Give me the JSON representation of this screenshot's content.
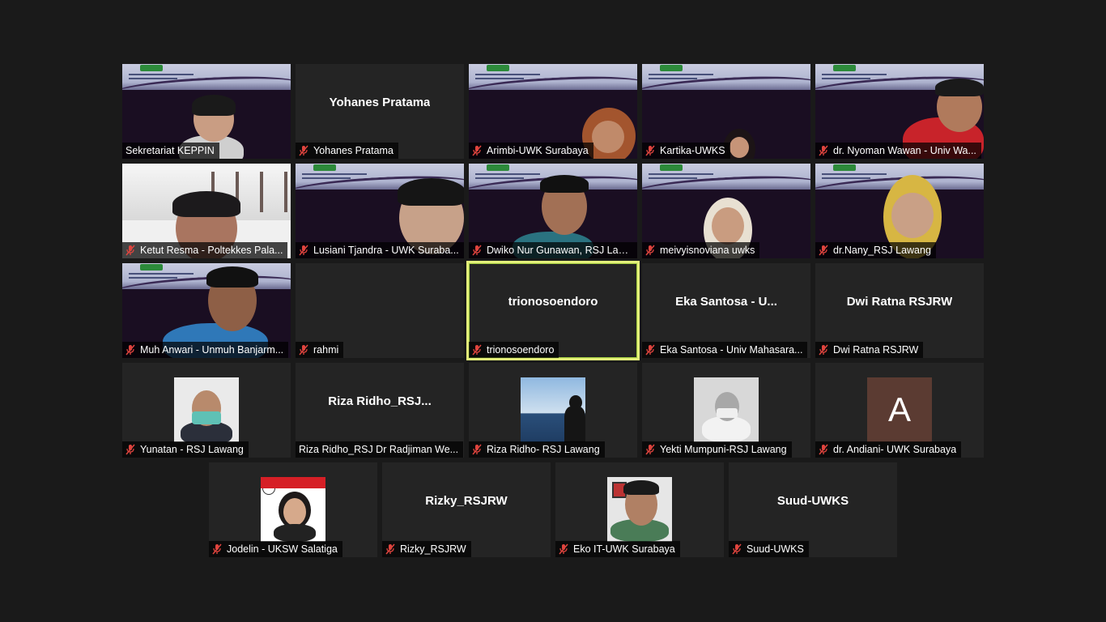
{
  "participants": [
    {
      "label": "Sekretariat KEPPIN",
      "muted": false
    },
    {
      "label": "Yohanes Pratama",
      "center": "Yohanes Pratama",
      "muted": true
    },
    {
      "label": "Arimbi-UWK Surabaya",
      "muted": true
    },
    {
      "label": "Kartika-UWKS",
      "muted": true
    },
    {
      "label": "dr. Nyoman Wawan - Univ Wa...",
      "muted": true
    },
    {
      "label": "Ketut Resma - Poltekkes Pala...",
      "muted": true
    },
    {
      "label": "Lusiani Tjandra - UWK Suraba...",
      "muted": true
    },
    {
      "label": "Dwiko Nur Gunawan, RSJ Law...",
      "muted": true
    },
    {
      "label": "meivyisnoviana uwks",
      "muted": true
    },
    {
      "label": "dr.Nany_RSJ Lawang",
      "muted": true
    },
    {
      "label": "Muh Anwari - Unmuh Banjarm...",
      "muted": true
    },
    {
      "label": "rahmi",
      "muted": true
    },
    {
      "label": "trionosoendoro",
      "center": "trionosoendoro",
      "muted": true
    },
    {
      "label": "Eka Santosa - Univ Mahasara...",
      "center": "Eka Santosa - U...",
      "muted": true
    },
    {
      "label": "Dwi Ratna RSJRW",
      "center": "Dwi Ratna RSJRW",
      "muted": true
    },
    {
      "label": "Yunatan - RSJ Lawang",
      "muted": true
    },
    {
      "label": "Riza Ridho_RSJ Dr Radjiman We...",
      "center": "Riza  Ridho_RSJ...",
      "muted": false
    },
    {
      "label": "Riza Ridho- RSJ Lawang",
      "muted": true
    },
    {
      "label": "Yekti Mumpuni-RSJ Lawang",
      "muted": true
    },
    {
      "label": "dr. Andiani- UWK Surabaya",
      "avatar": "A",
      "muted": true
    },
    {
      "label": "Jodelin - UKSW Salatiga",
      "muted": true
    },
    {
      "label": "Rizky_RSJRW",
      "center": "Rizky_RSJRW",
      "muted": true
    },
    {
      "label": "Eko IT-UWK Surabaya",
      "muted": true
    },
    {
      "label": "Suud-UWKS",
      "center": "Suud-UWKS",
      "muted": true
    }
  ],
  "colors": {
    "active_border": "#e3ef7a",
    "muted_icon": "#e0443e",
    "tile_bg": "#242424",
    "page_bg": "#1a1a1a"
  }
}
